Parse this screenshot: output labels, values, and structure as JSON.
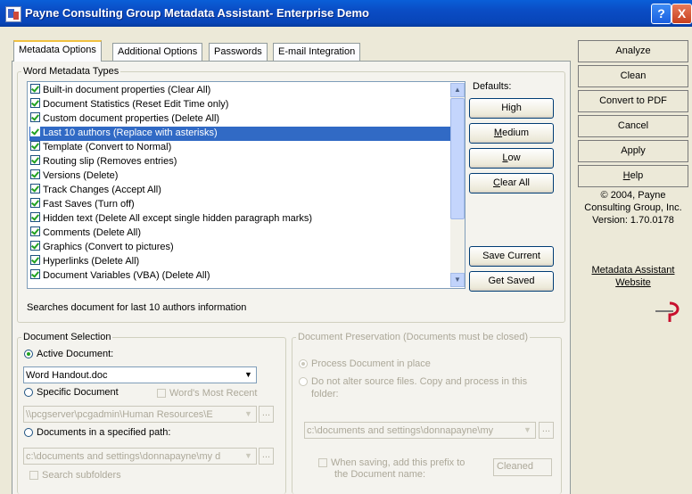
{
  "window": {
    "title": "Payne Consulting Group Metadata Assistant- Enterprise Demo",
    "help_glyph": "?",
    "close_glyph": "X"
  },
  "tabs": [
    "Metadata Options",
    "Additional Options",
    "Passwords",
    "E-mail Integration"
  ],
  "word_metadata": {
    "legend": "Word Metadata Types",
    "items": [
      "Built-in document properties (Clear All)",
      "Document Statistics (Reset Edit Time only)",
      "Custom document properties (Delete All)",
      "Last 10 authors (Replace with asterisks)",
      "Template (Convert to Normal)",
      "Routing slip (Removes entries)",
      "Versions (Delete)",
      "Track Changes (Accept All)",
      "Fast Saves (Turn off)",
      "Hidden text (Delete All except single hidden paragraph marks)",
      "Comments (Delete All)",
      "Graphics (Convert to pictures)",
      "Hyperlinks (Delete All)",
      "Document Variables (VBA) (Delete All)"
    ],
    "selected_index": 3,
    "description": "Searches document for last 10 authors information"
  },
  "defaults": {
    "label": "Defaults:",
    "high": "High",
    "medium": "Medium",
    "low": "Low",
    "clear_all": "Clear All",
    "save_current": "Save Current",
    "get_saved": "Get Saved"
  },
  "document_selection": {
    "legend": "Document Selection",
    "active_label": "Active Document:",
    "active_value": "Word Handout.doc",
    "specific_label": "Specific Document",
    "words_most_recent": "Word's Most Recent",
    "specific_value": "\\\\pcgserver\\pcgadmin\\Human Resources\\E",
    "path_label": "Documents in a specified path:",
    "path_value": "c:\\documents and settings\\donnapayne\\my d",
    "subfolders_label": "Search subfolders",
    "browse": "..."
  },
  "document_preservation": {
    "legend": "Document Preservation (Documents must be closed)",
    "process_in_place": "Process Document in place",
    "do_not_alter_line1": "Do not alter source files. Copy and process in this",
    "do_not_alter_line2": "folder:",
    "folder_value": "c:\\documents and settings\\donnapayne\\my",
    "prefix_line1": "When saving, add this prefix to",
    "prefix_line2": "the Document name:",
    "prefix_value": "Cleaned",
    "browse": "..."
  },
  "sidebar": {
    "analyze": "Analyze",
    "clean": "Clean",
    "convert_pdf": "Convert to PDF",
    "cancel": "Cancel",
    "apply": "Apply",
    "help": "Help",
    "copyright1": "© 2004, Payne",
    "copyright2": "Consulting Group, Inc.",
    "version": "Version: 1.70.0178",
    "website1": "Metadata Assistant",
    "website2": "Website"
  },
  "colors": {
    "titlebar": "#0a4cc4",
    "selection": "#316ac5",
    "check": "#21a121",
    "logo_red": "#c8102e"
  }
}
